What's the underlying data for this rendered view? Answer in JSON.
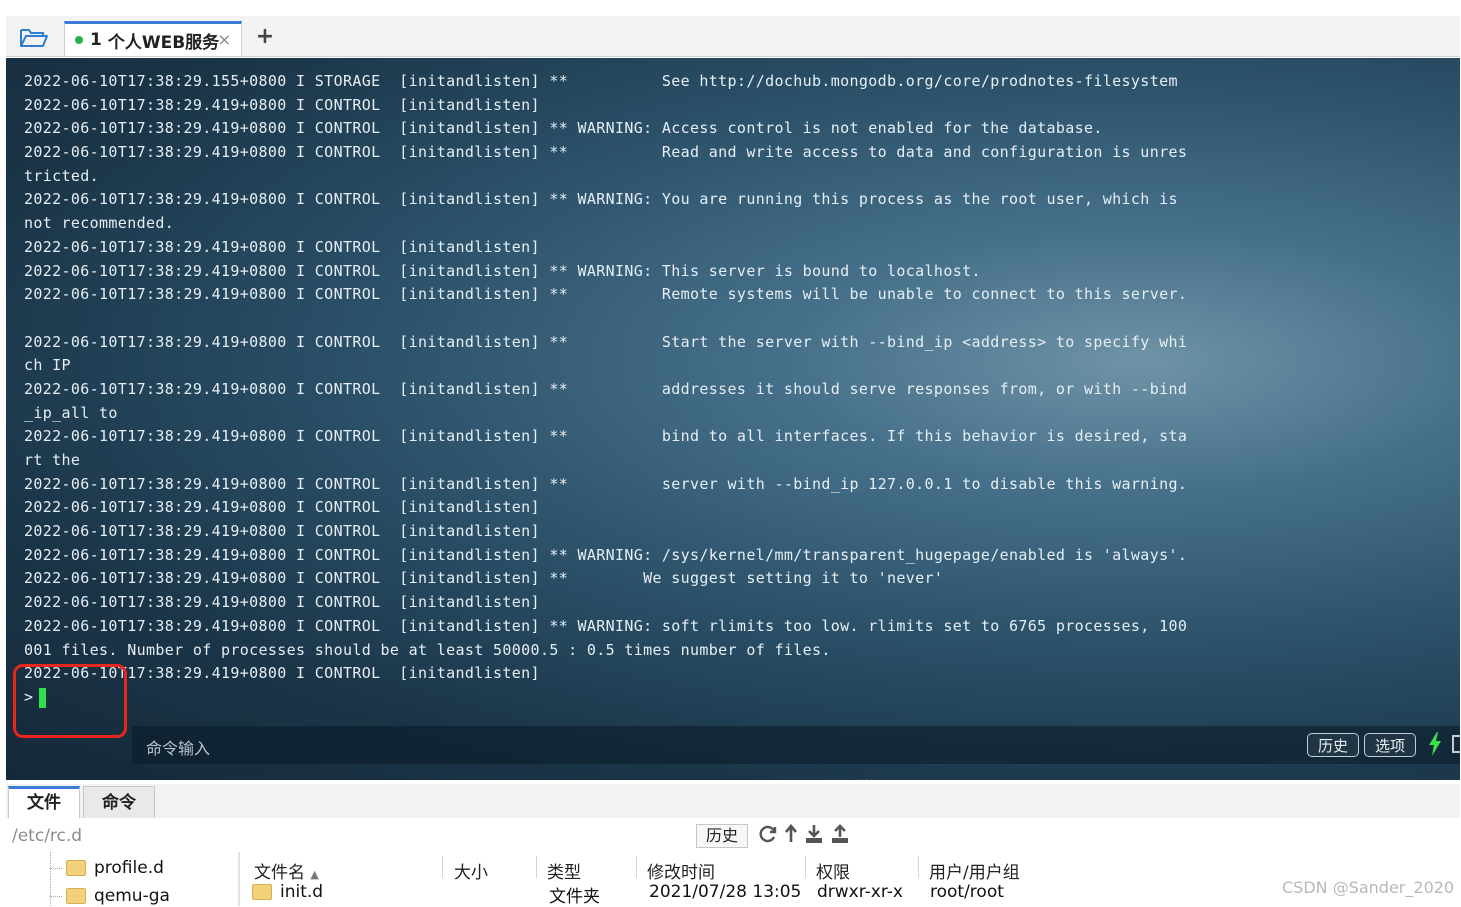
{
  "session_tab": {
    "number": "1",
    "title": "个人WEB服务",
    "close": "×"
  },
  "new_tab": "+",
  "terminal": {
    "lines": [
      "2022-06-10T17:38:29.155+0800 I STORAGE  [initandlisten] **          See http://dochub.mongodb.org/core/prodnotes-filesystem",
      "2022-06-10T17:38:29.419+0800 I CONTROL  [initandlisten]",
      "2022-06-10T17:38:29.419+0800 I CONTROL  [initandlisten] ** WARNING: Access control is not enabled for the database.",
      "2022-06-10T17:38:29.419+0800 I CONTROL  [initandlisten] **          Read and write access to data and configuration is unres",
      "tricted.",
      "2022-06-10T17:38:29.419+0800 I CONTROL  [initandlisten] ** WARNING: You are running this process as the root user, which is",
      "not recommended.",
      "2022-06-10T17:38:29.419+0800 I CONTROL  [initandlisten]",
      "2022-06-10T17:38:29.419+0800 I CONTROL  [initandlisten] ** WARNING: This server is bound to localhost.",
      "2022-06-10T17:38:29.419+0800 I CONTROL  [initandlisten] **          Remote systems will be unable to connect to this server.",
      "",
      "2022-06-10T17:38:29.419+0800 I CONTROL  [initandlisten] **          Start the server with --bind_ip <address> to specify whi",
      "ch IP",
      "2022-06-10T17:38:29.419+0800 I CONTROL  [initandlisten] **          addresses it should serve responses from, or with --bind",
      "_ip_all to",
      "2022-06-10T17:38:29.419+0800 I CONTROL  [initandlisten] **          bind to all interfaces. If this behavior is desired, sta",
      "rt the",
      "2022-06-10T17:38:29.419+0800 I CONTROL  [initandlisten] **          server with --bind_ip 127.0.0.1 to disable this warning.",
      "2022-06-10T17:38:29.419+0800 I CONTROL  [initandlisten]",
      "2022-06-10T17:38:29.419+0800 I CONTROL  [initandlisten]",
      "2022-06-10T17:38:29.419+0800 I CONTROL  [initandlisten] ** WARNING: /sys/kernel/mm/transparent_hugepage/enabled is 'always'.",
      "2022-06-10T17:38:29.419+0800 I CONTROL  [initandlisten] **        We suggest setting it to 'never'",
      "2022-06-10T17:38:29.419+0800 I CONTROL  [initandlisten]",
      "2022-06-10T17:38:29.419+0800 I CONTROL  [initandlisten] ** WARNING: soft rlimits too low. rlimits set to 6765 processes, 100",
      "001 files. Number of processes should be at least 50000.5 : 0.5 times number of files.",
      "2022-06-10T17:38:29.419+0800 I CONTROL  [initandlisten]"
    ],
    "prompt": ">",
    "cursor_color": "#2fe04b",
    "highlight_color": "#e8261b"
  },
  "command_bar": {
    "placeholder": "命令输入",
    "history_label": "历史",
    "options_label": "选项"
  },
  "bottom_tabs": [
    "文件",
    "命令"
  ],
  "path_bar": {
    "path": "/etc/rc.d",
    "history_label": "历史"
  },
  "tree": {
    "items": [
      "profile.d",
      "qemu-ga"
    ]
  },
  "file_table": {
    "columns": [
      "文件名",
      "大小",
      "类型",
      "修改时间",
      "权限",
      "用户/用户组"
    ],
    "rows": [
      {
        "name": "init.d",
        "size": "",
        "type": "文件夹",
        "modified": "2021/07/28 13:05",
        "perms": "drwxr-xr-x",
        "owner": "root/root"
      }
    ]
  },
  "watermark": "CSDN @Sander_2020"
}
